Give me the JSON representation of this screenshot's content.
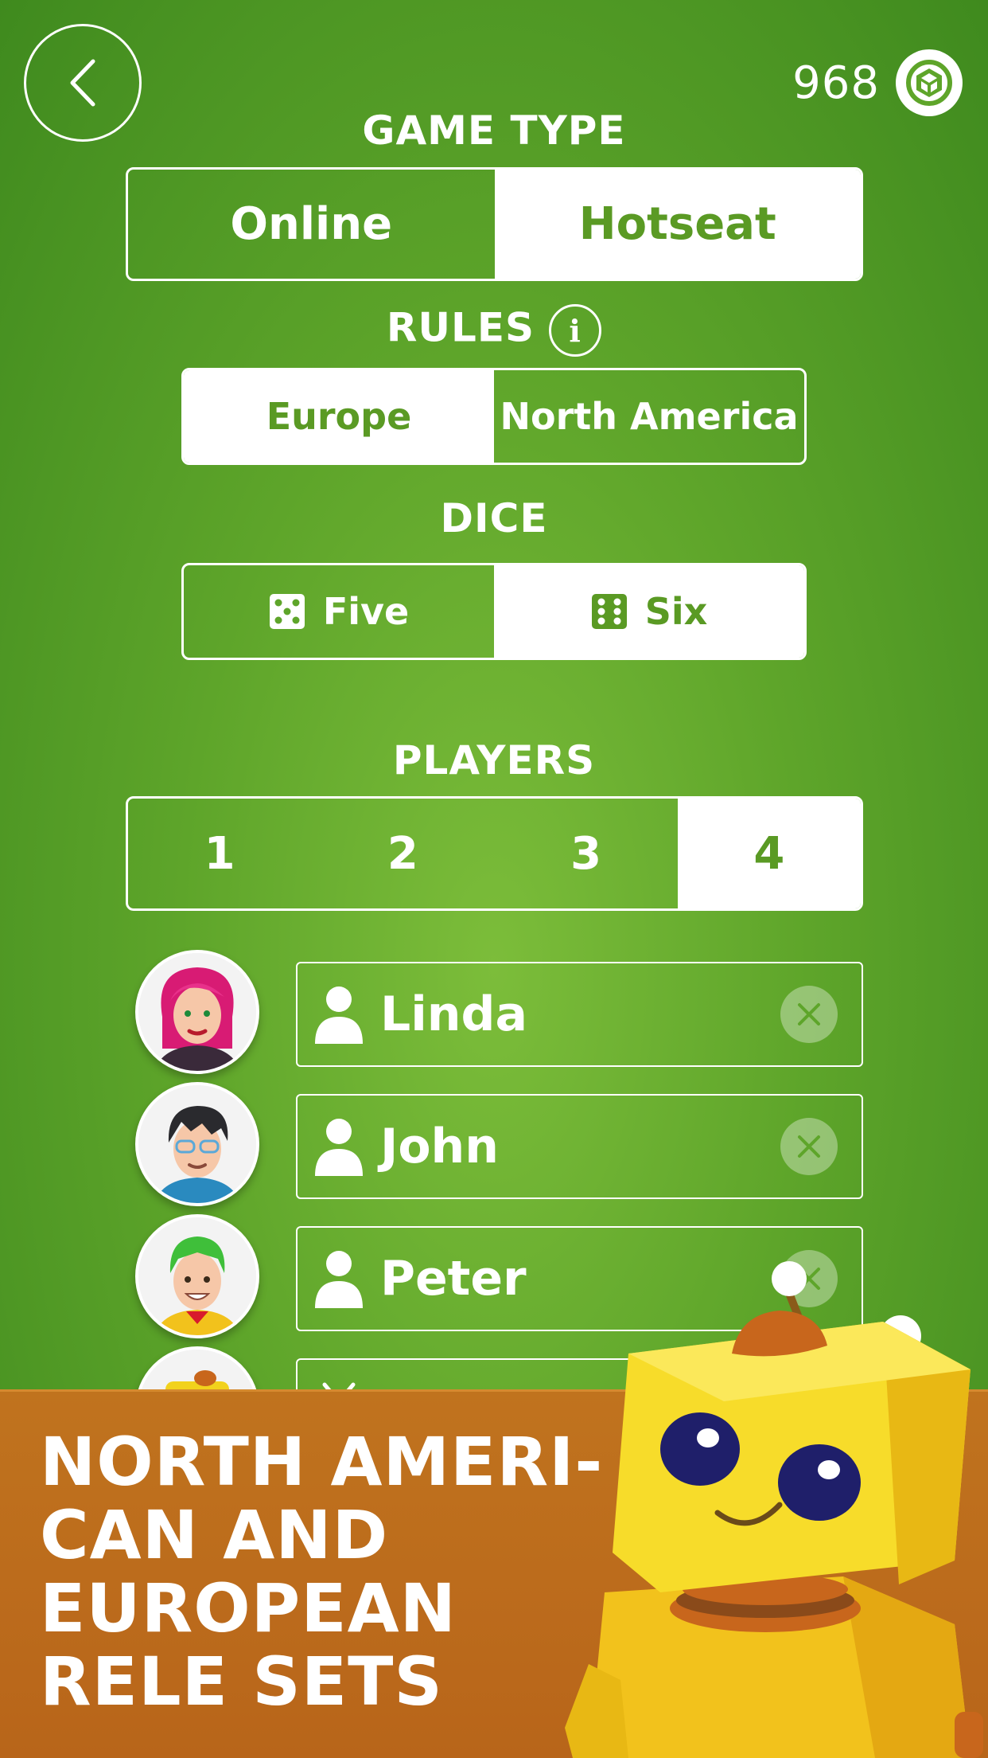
{
  "top": {
    "coins": "968",
    "back_icon": "chevron-left-icon",
    "coin_icon": "cube-coin-icon"
  },
  "game_type": {
    "title": "GAME TYPE",
    "options": [
      "Online",
      "Hotseat"
    ],
    "selected": "Hotseat"
  },
  "rules": {
    "title": "RULES",
    "info_glyph": "i",
    "options": [
      "Europe",
      "North America"
    ],
    "selected": "Europe"
  },
  "dice": {
    "title": "DICE",
    "options": [
      "Five",
      "Six"
    ],
    "selected": "Six"
  },
  "players": {
    "title": "PLAYERS",
    "counts": [
      "1",
      "2",
      "3",
      "4"
    ],
    "selected": "4",
    "list": [
      {
        "name": "Linda"
      },
      {
        "name": "John"
      },
      {
        "name": "Peter"
      }
    ]
  },
  "banner": {
    "lines": [
      "NORTH AMERI-",
      "CAN AND",
      "EUROPEAN",
      "RELE SETS"
    ]
  },
  "colors": {
    "felt_green": "#5ea52a",
    "accent_green": "#5a9a24",
    "banner_orange": "#b8651a",
    "robot_yellow": "#f2d21c"
  }
}
